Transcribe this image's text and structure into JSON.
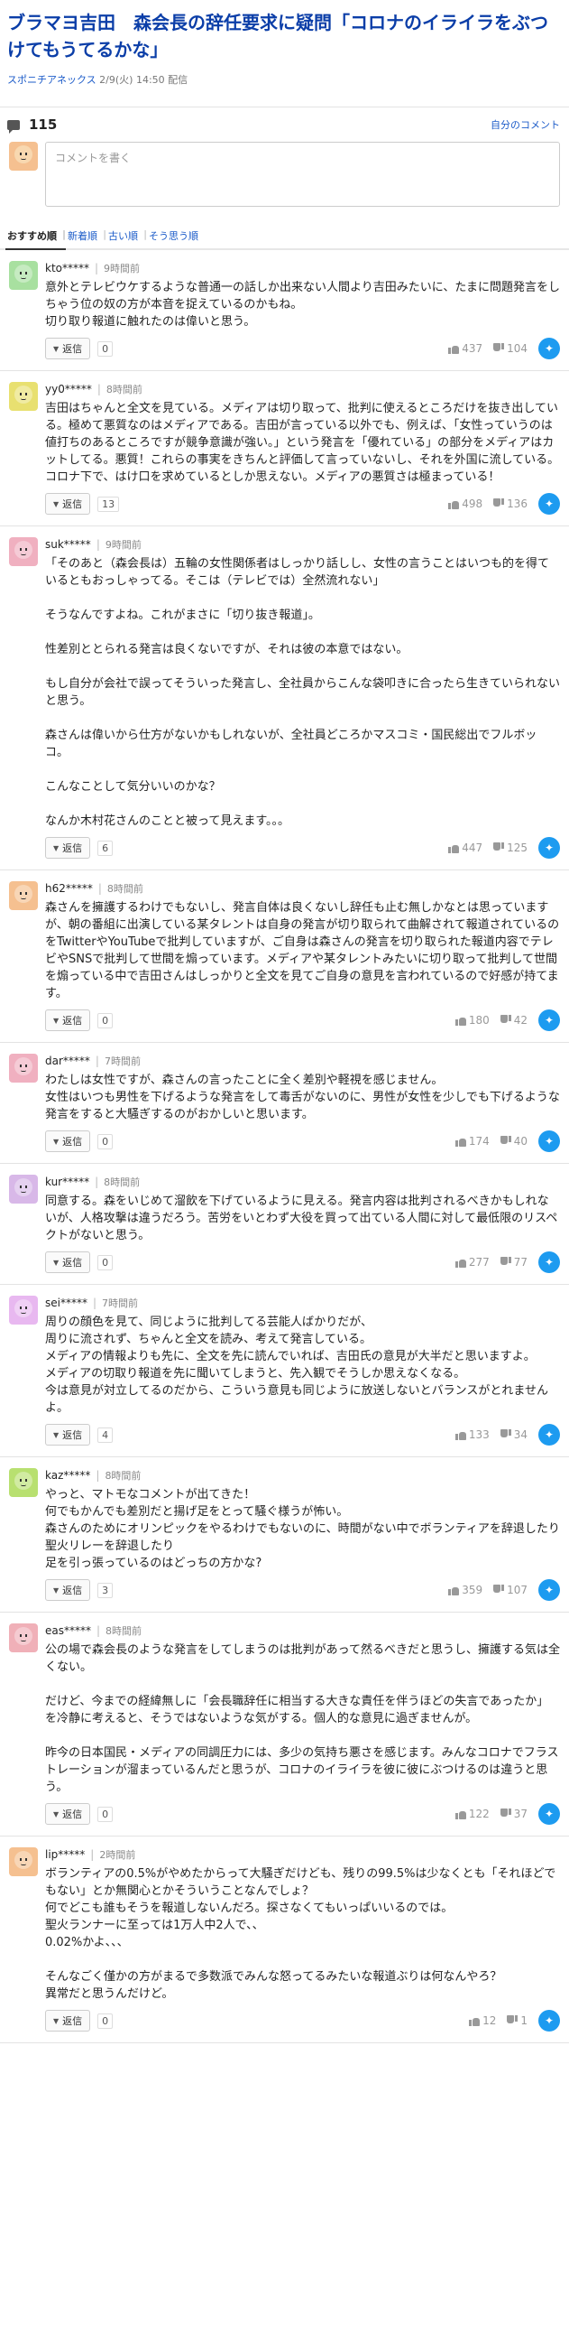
{
  "article": {
    "title": "ブラマヨ吉田　森会長の辞任要求に疑問「コロナのイライラをぶつけてもうてるかな」",
    "source": "スポニチアネックス",
    "date": "2/9(火) 14:50 配信"
  },
  "comments_header": {
    "count": "115",
    "my_comments": "自分のコメント",
    "compose_placeholder": "コメントを書く"
  },
  "tabs": [
    "おすすめ順",
    "新着順",
    "古い順",
    "そう思う順"
  ],
  "reply_label": "返信",
  "colors": {
    "title": "#0b3ea8",
    "link": "#1d5cc9",
    "twitter": "#1d9bf0"
  },
  "comments": [
    {
      "user": "kto*****",
      "time": "9時間前",
      "avatar_color": "#a8e0a0",
      "text": "意外とテレビウケするような普通一の話しか出来ない人間より吉田みたいに、たまに問題発言をしちゃう位の奴の方が本音を捉えているのかもね。\n切り取り報道に触れたのは偉いと思う。",
      "replies": "0",
      "likes": "437",
      "dislikes": "104"
    },
    {
      "user": "yy0*****",
      "time": "8時間前",
      "avatar_color": "#e8e070",
      "text": "吉田はちゃんと全文を見ている。メディアは切り取って、批判に使えるところだけを抜き出している。極めて悪質なのはメディアである。吉田が言っている以外でも、例えば、「女性っていうのは値打ちのあるところですが競争意識が強い。」という発言を「優れている」の部分をメディアはカットしてる。悪質！これらの事実をきちんと評価して言っていないし、それを外国に流している。コロナ下で、はけ口を求めているとしか思えない。メディアの悪質さは極まっている！",
      "replies": "13",
      "likes": "498",
      "dislikes": "136"
    },
    {
      "user": "suk*****",
      "time": "9時間前",
      "avatar_color": "#f0b0c0",
      "text": "「そのあと（森会長は）五輪の女性関係者はしっかり話しし、女性の言うことはいつも的を得ているともおっしゃってる。そこは（テレビでは）全然流れない」\n\nそうなんですよね。これがまさに「切り抜き報道」。\n\n性差別ととられる発言は良くないですが、それは彼の本意ではない。\n\nもし自分が会社で誤ってそういった発言し、全社員からこんな袋叩きに合ったら生きていられないと思う。\n\n森さんは偉いから仕方がないかもしれないが、全社員どころかマスコミ・国民総出でフルボッコ。\n\nこんなことして気分いいのかな？\n\nなんか木村花さんのことと被って見えます。。。",
      "replies": "6",
      "likes": "447",
      "dislikes": "125"
    },
    {
      "user": "h62*****",
      "time": "8時間前",
      "avatar_color": "#f5c090",
      "text": "森さんを擁護するわけでもないし、発言自体は良くないし辞任も止む無しかなとは思っていますが、朝の番組に出演している某タレントは自身の発言が切り取られて曲解されて報道されているのをTwitterやYouTubeで批判していますが、ご自身は森さんの発言を切り取られた報道内容でテレビやSNSで批判して世間を煽っています。メディアや某タレントみたいに切り取って批判して世間を煽っている中で吉田さんはしっかりと全文を見てご自身の意見を言われているので好感が持てます。",
      "replies": "0",
      "likes": "180",
      "dislikes": "42"
    },
    {
      "user": "dar*****",
      "time": "7時間前",
      "avatar_color": "#f0b0c0",
      "text": "わたしは女性ですが、森さんの言ったことに全く差別や軽視を感じません。\n女性はいつも男性を下げるような発言をして毒舌がないのに、男性が女性を少しでも下げるような発言をすると大騒ぎするのがおかしいと思います。",
      "replies": "0",
      "likes": "174",
      "dislikes": "40"
    },
    {
      "user": "kur*****",
      "time": "8時間前",
      "avatar_color": "#d8b8e8",
      "text": "同意する。森をいじめて溜飲を下げているように見える。発言内容は批判されるべきかもしれないが、人格攻撃は違うだろう。苦労をいとわず大役を買って出ている人間に対して最低限のリスペクトがないと思う。",
      "replies": "0",
      "likes": "277",
      "dislikes": "77"
    },
    {
      "user": "sei*****",
      "time": "7時間前",
      "avatar_color": "#e8b8f0",
      "text": "周りの顔色を見て、同じように批判してる芸能人ばかりだが、\n周りに流されず、ちゃんと全文を読み、考えて発言している。\nメディアの情報よりも先に、全文を先に読んでいれば、吉田氏の意見が大半だと思いますよ。\nメディアの切取り報道を先に聞いてしまうと、先入観でそうしか思えなくなる。\n今は意見が対立してるのだから、こういう意見も同じように放送しないとバランスがとれませんよ。",
      "replies": "4",
      "likes": "133",
      "dislikes": "34"
    },
    {
      "user": "kaz*****",
      "time": "8時間前",
      "avatar_color": "#b8e070",
      "text": "やっと、マトモなコメントが出てきた！\n何でもかんでも差別だと揚げ足をとって騒ぐ様うが怖い。\n森さんのためにオリンピックをやるわけでもないのに、時間がない中でボランティアを辞退したり聖火リレーを辞退したり\n足を引っ張っているのはどっちの方かな?",
      "replies": "3",
      "likes": "359",
      "dislikes": "107"
    },
    {
      "user": "eas*****",
      "time": "8時間前",
      "avatar_color": "#f0b0b8",
      "text": "公の場で森会長のような発言をしてしまうのは批判があって然るべきだと思うし、擁護する気は全くない。\n\nだけど、今までの経緯無しに「会長職辞任に相当する大きな責任を伴うほどの失言であったか」を冷静に考えると、そうではないような気がする。個人的な意見に過ぎませんが。\n\n昨今の日本国民・メディアの同調圧力には、多少の気持ち悪さを感じます。みんなコロナでフラストレーションが溜まっているんだと思うが、コロナのイライラを彼に彼にぶつけるのは違うと思う。",
      "replies": "0",
      "likes": "122",
      "dislikes": "37"
    },
    {
      "user": "lip*****",
      "time": "2時間前",
      "avatar_color": "#f5c090",
      "text": "ボランティアの0.5%がやめたからって大騒ぎだけども、残りの99.5%は少なくとも「それほどでもない」とか無関心とかそういうことなんでしょ？\n何でどこも誰もそうを報道しないんだろ。探さなくてもいっぱいいるのでは。\n聖火ランナーに至っては1万人中2人で、、\n0.02%かよ、、、\n\nそんなごく僅かの方がまるで多数派でみんな怒ってるみたいな報道ぶりは何なんやろ？\n異常だと思うんだけど。",
      "replies": "0",
      "likes": "12",
      "dislikes": "1"
    }
  ]
}
